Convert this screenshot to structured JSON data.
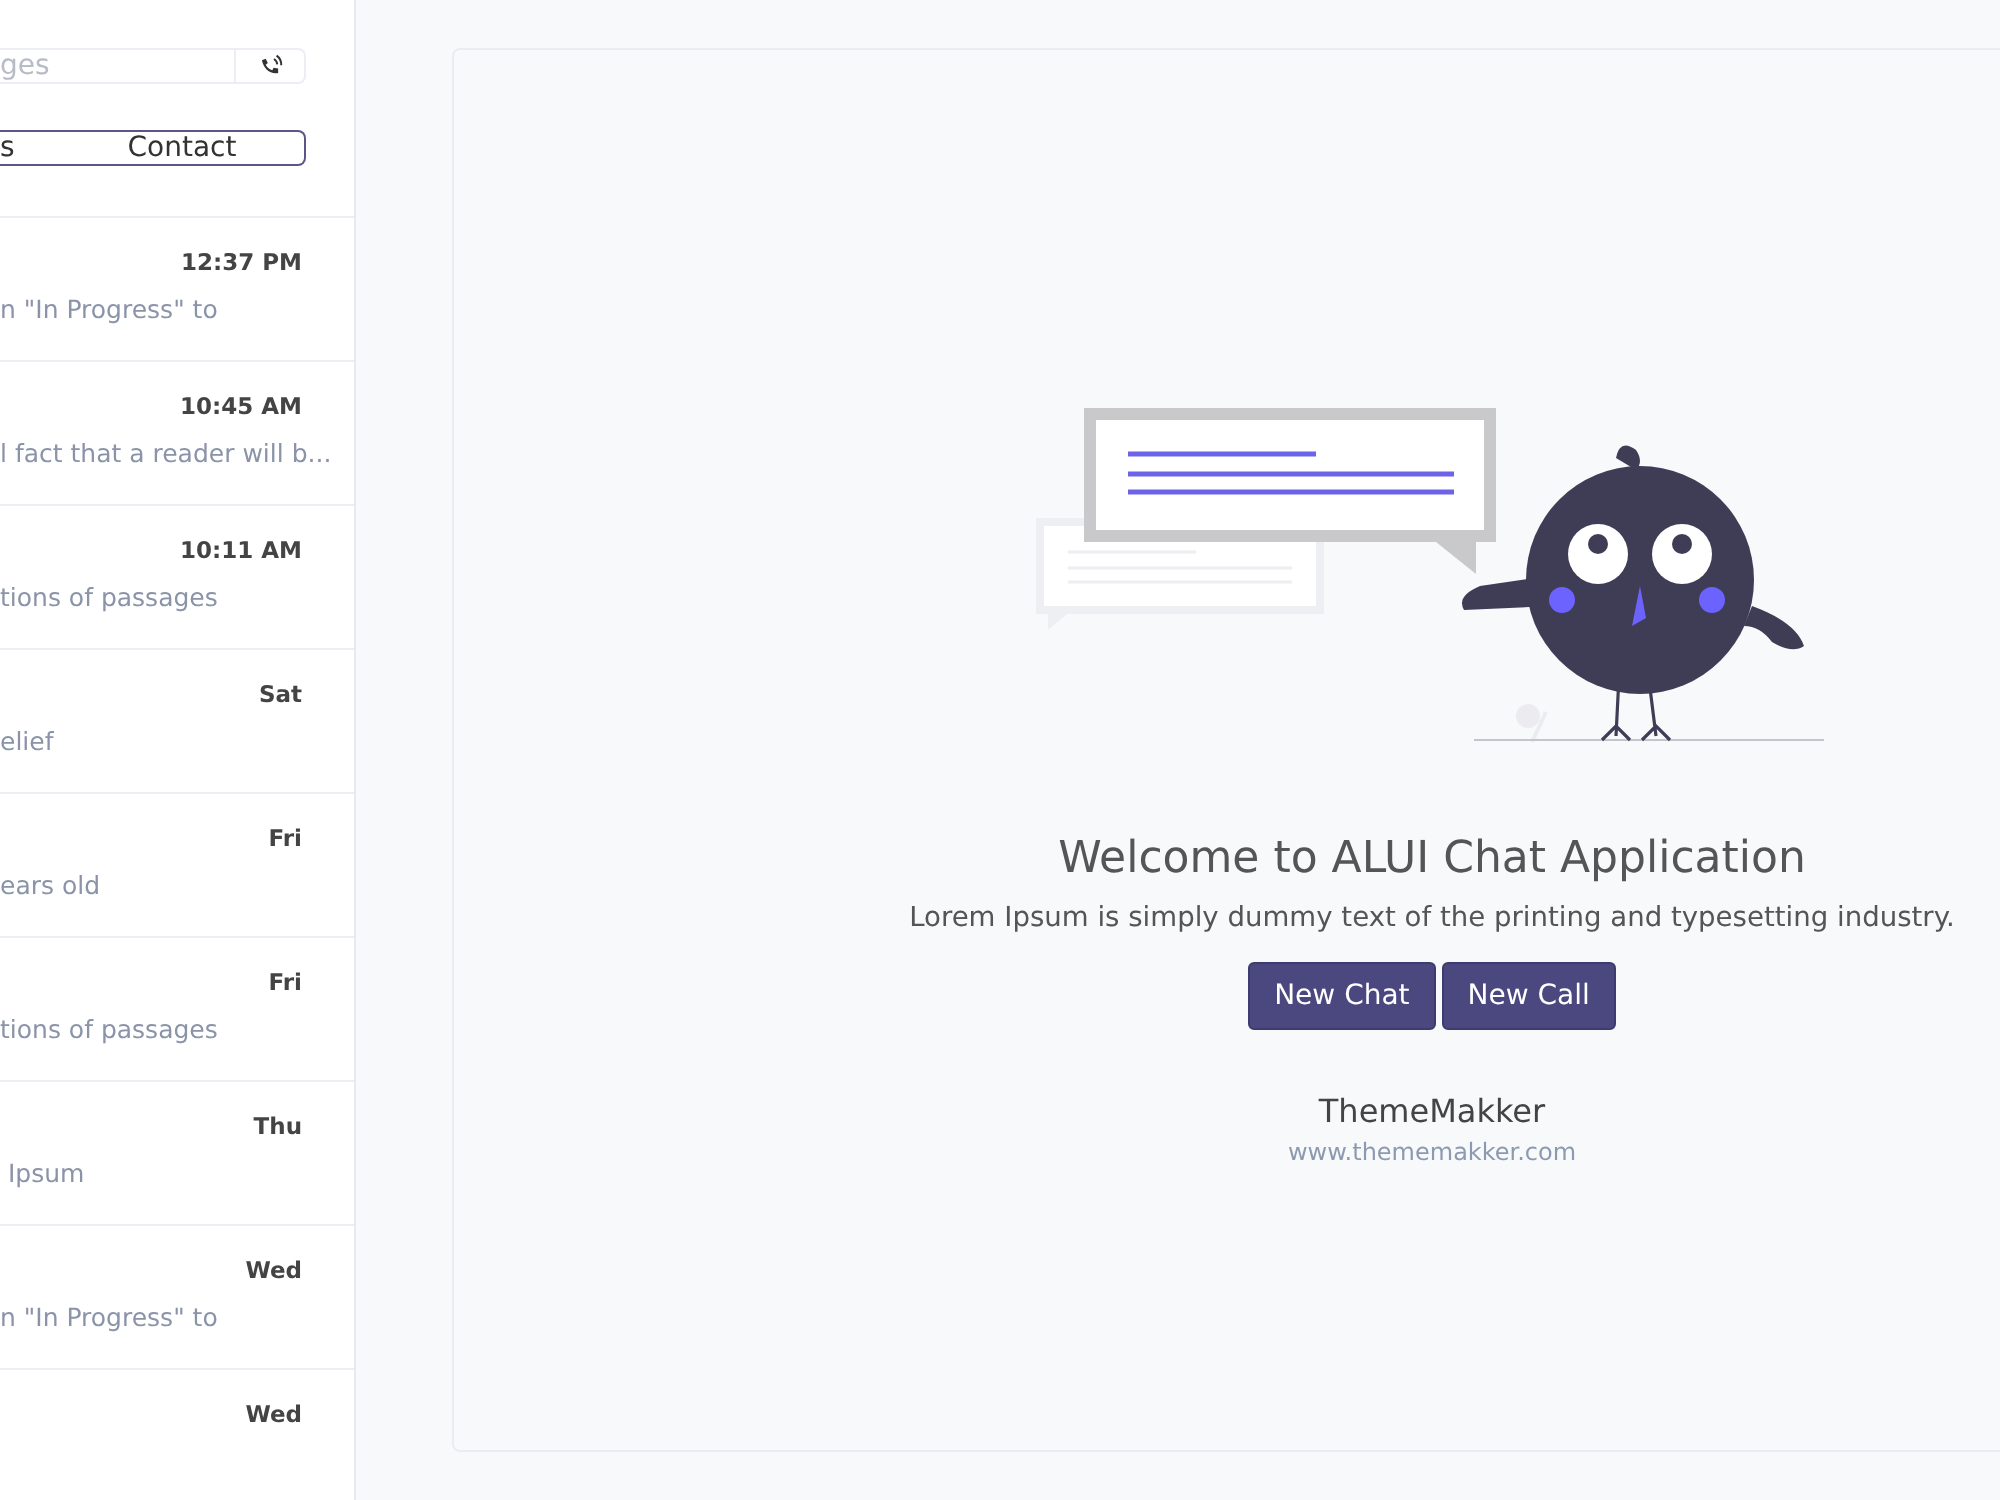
{
  "sidebar": {
    "search": {
      "placeholder": "ges"
    },
    "tabs": [
      {
        "label": "s",
        "selected": false
      },
      {
        "label": "Contact",
        "selected": false
      }
    ],
    "chats": [
      {
        "time": "12:37 PM",
        "preview": "n \"In Progress\" to"
      },
      {
        "time": "10:45 AM",
        "preview": "l fact that a reader will b..."
      },
      {
        "time": "10:11 AM",
        "preview": "tions of passages"
      },
      {
        "time": "Sat",
        "preview": "elief"
      },
      {
        "time": "Fri",
        "preview": "ears old"
      },
      {
        "time": "Fri",
        "preview": "tions of passages"
      },
      {
        "time": "Thu",
        "preview": " Ipsum"
      },
      {
        "time": "Wed",
        "preview": "n \"In Progress\" to"
      },
      {
        "time": "Wed"
      }
    ]
  },
  "welcome": {
    "title": "Welcome to ALUI Chat Application",
    "subtitle": "Lorem Ipsum is simply dummy text of the printing and typesetting industry.",
    "buttons": [
      "New Chat",
      "New Call"
    ],
    "brand": "ThemeMakker",
    "url": "www.thememakker.com"
  }
}
